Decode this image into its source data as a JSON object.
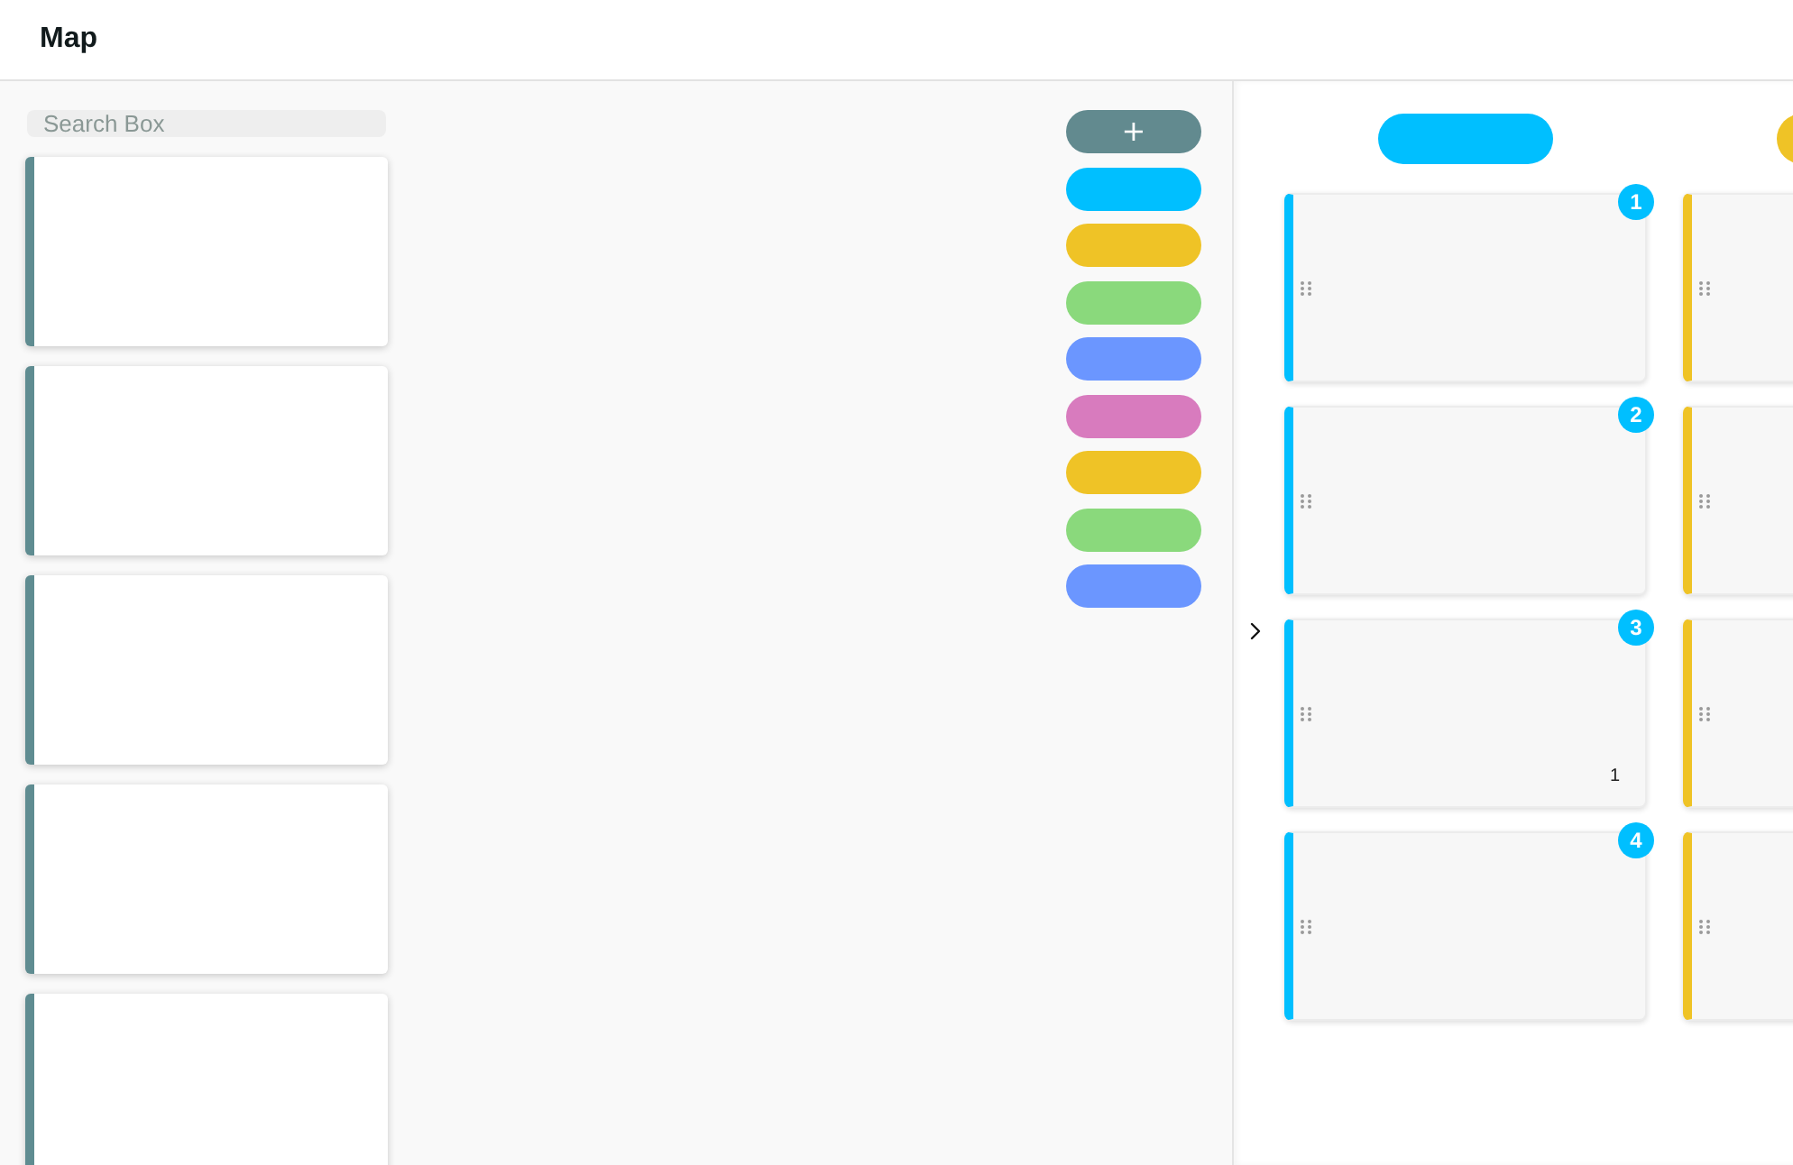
{
  "header": {
    "title": "Map"
  },
  "library": {
    "search": {
      "placeholder": "Search Box"
    },
    "cards": [
      {
        "color": "#5f8c91"
      },
      {
        "color": "#5f8c91"
      },
      {
        "color": "#5f8c91"
      },
      {
        "color": "#5f8c91"
      },
      {
        "color": "#5f8c91"
      }
    ]
  },
  "palette": [
    {
      "kind": "add",
      "label": "+",
      "color": "#628a8f"
    },
    {
      "kind": "swatch",
      "color": "#00bfff"
    },
    {
      "kind": "swatch",
      "color": "#efc326"
    },
    {
      "kind": "swatch",
      "color": "#8ad97c"
    },
    {
      "kind": "swatch",
      "color": "#6b96ff"
    },
    {
      "kind": "swatch",
      "color": "#d87bbe"
    },
    {
      "kind": "swatch",
      "color": "#efc326"
    },
    {
      "kind": "swatch",
      "color": "#8ad97c"
    },
    {
      "kind": "swatch",
      "color": "#6b96ff"
    }
  ],
  "board": {
    "columns": [
      {
        "color": "#00bfff",
        "cards": [
          {
            "number": "1",
            "handle": true
          },
          {
            "number": "2",
            "handle": true
          },
          {
            "number": "3",
            "count": "1",
            "handle": true
          },
          {
            "number": "4",
            "handle": true
          }
        ]
      },
      {
        "color": "#efc326",
        "cards": [
          {
            "handle": true
          },
          {
            "handle": true
          },
          {
            "handle": true
          },
          {
            "handle": true
          }
        ]
      }
    ]
  }
}
